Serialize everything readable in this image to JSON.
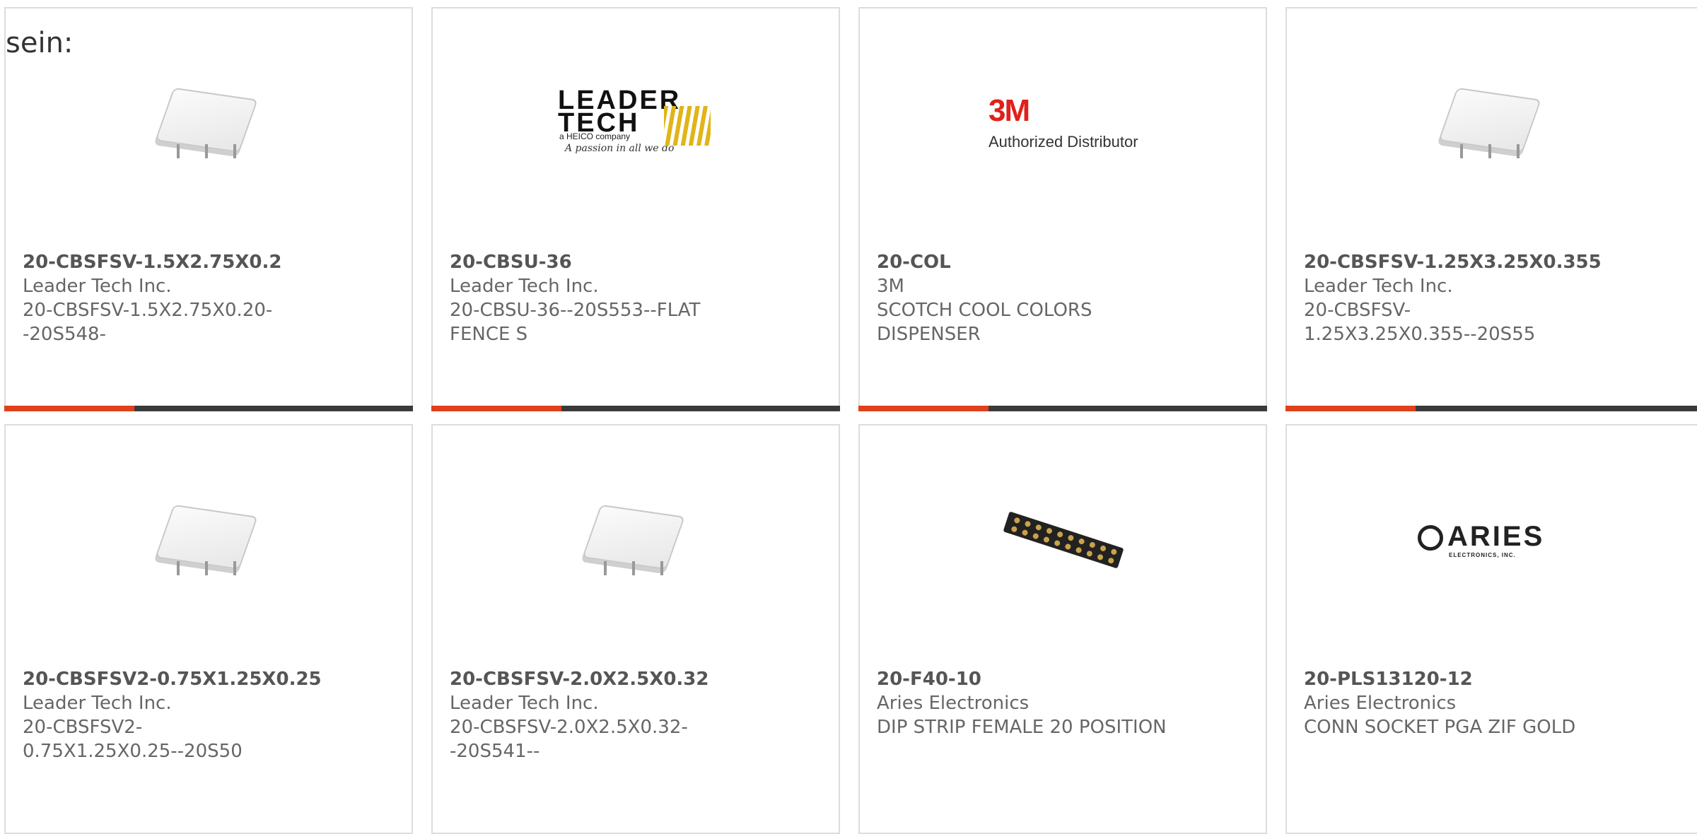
{
  "intro_text": "sein:",
  "colors": {
    "accent": "#e0401a",
    "bar": "#3a3a3a",
    "border": "#dddddd"
  },
  "products": [
    {
      "part_number": "20-CBSFSV-1.5X2.75X0.2",
      "manufacturer": "Leader Tech Inc.",
      "description": "20-CBSFSV-1.5X2.75X0.20--20S548-",
      "image": "rf-shield-icon"
    },
    {
      "part_number": "20-CBSU-36",
      "manufacturer": "Leader Tech Inc.",
      "description": "20-CBSU-36--20S553--FLAT FENCE S",
      "image": "leader-tech-logo"
    },
    {
      "part_number": "20-COL",
      "manufacturer": "3M",
      "description": "SCOTCH COOL COLORS DISPENSER",
      "image": "3m-logo"
    },
    {
      "part_number": "20-CBSFSV-1.25X3.25X0.355",
      "manufacturer": "Leader Tech Inc.",
      "description": "20-CBSFSV-1.25X3.25X0.355--20S55",
      "image": "rf-shield-icon"
    },
    {
      "part_number": "20-CBSFSV2-0.75X1.25X0.25",
      "manufacturer": "Leader Tech Inc.",
      "description": "20-CBSFSV2-0.75X1.25X0.25--20S50",
      "image": "rf-shield-icon"
    },
    {
      "part_number": "20-CBSFSV-2.0X2.5X0.32",
      "manufacturer": "Leader Tech Inc.",
      "description": "20-CBSFSV-2.0X2.5X0.32--20S541--",
      "image": "rf-shield-icon"
    },
    {
      "part_number": "20-F40-10",
      "manufacturer": "Aries Electronics",
      "description": "DIP STRIP FEMALE 20 POSITION",
      "image": "dip-strip-icon"
    },
    {
      "part_number": "20-PLS13120-12",
      "manufacturer": "Aries Electronics",
      "description": "CONN SOCKET PGA ZIF GOLD",
      "image": "aries-logo"
    }
  ],
  "logos": {
    "leader_line1": "LEADER",
    "leader_line2": "TECH",
    "leader_sub": "a HEICO company",
    "leader_tagline": "A passion in all we do",
    "threem_mark": "3M",
    "threem_text": "Authorized Distributor",
    "aries_name": "ARIES",
    "aries_sub": "ELECTRONICS, INC."
  }
}
